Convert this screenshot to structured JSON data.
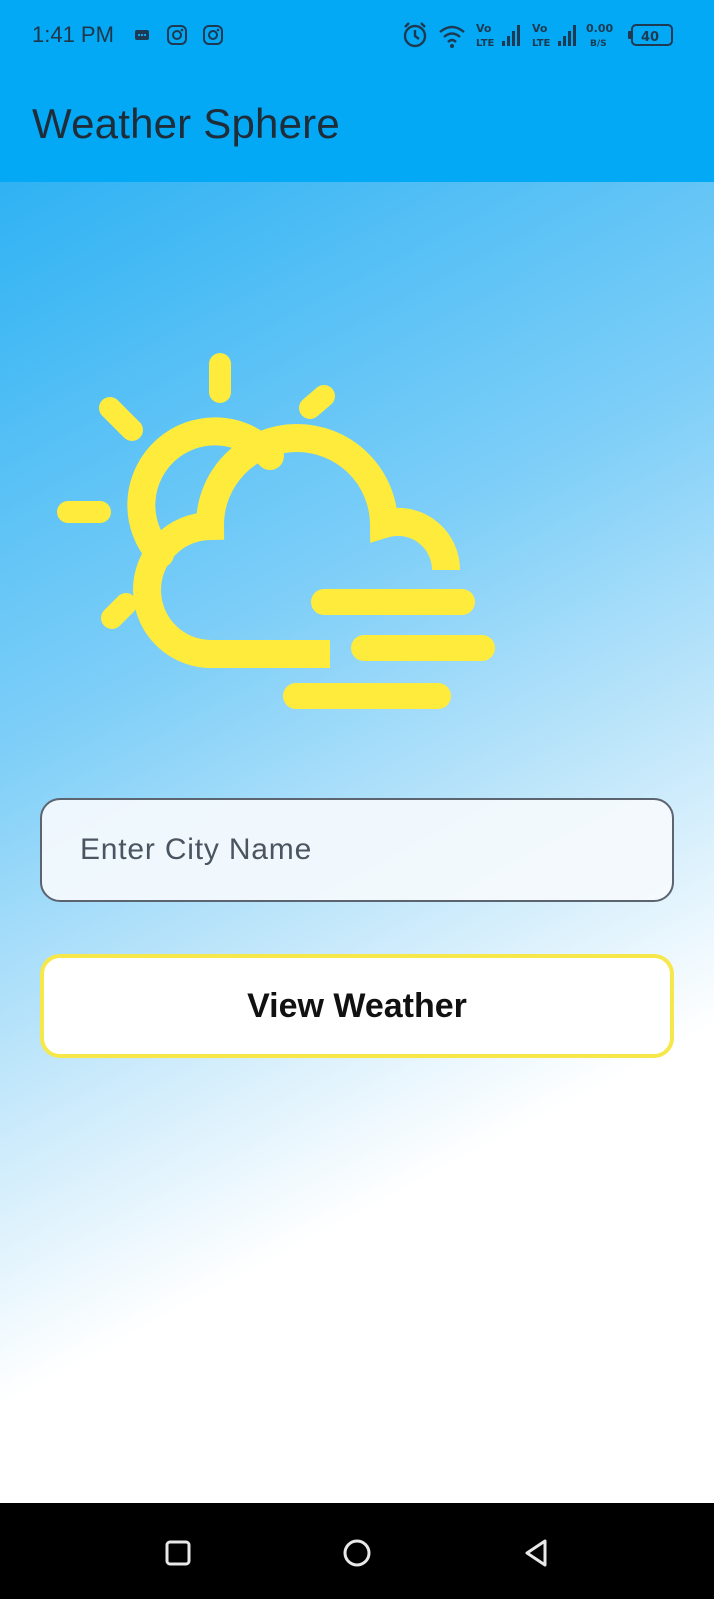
{
  "status_bar": {
    "time": "1:41 PM",
    "network_speed_value": "0.00",
    "network_speed_unit": "B/S",
    "battery": "40",
    "vo_label": "Vo",
    "lte_label": "LTE",
    "icons": [
      "message-icon",
      "instagram-icon",
      "instagram-icon",
      "alarm-icon",
      "wifi-icon",
      "volte-icon",
      "signal-icon",
      "volte-icon",
      "signal-icon",
      "battery-icon"
    ]
  },
  "app_bar": {
    "title": "Weather Sphere",
    "color": "#03a9f4"
  },
  "main": {
    "illustration_icon": "partly-cloudy-windy-icon",
    "illustration_color": "#ffeb3b",
    "city_input": {
      "placeholder": "Enter City Name",
      "value": ""
    },
    "view_button_label": "View Weather",
    "button_border_color": "#f6e84b"
  },
  "nav_bar": {
    "buttons": [
      "recent-apps-icon",
      "home-icon",
      "back-icon"
    ]
  }
}
